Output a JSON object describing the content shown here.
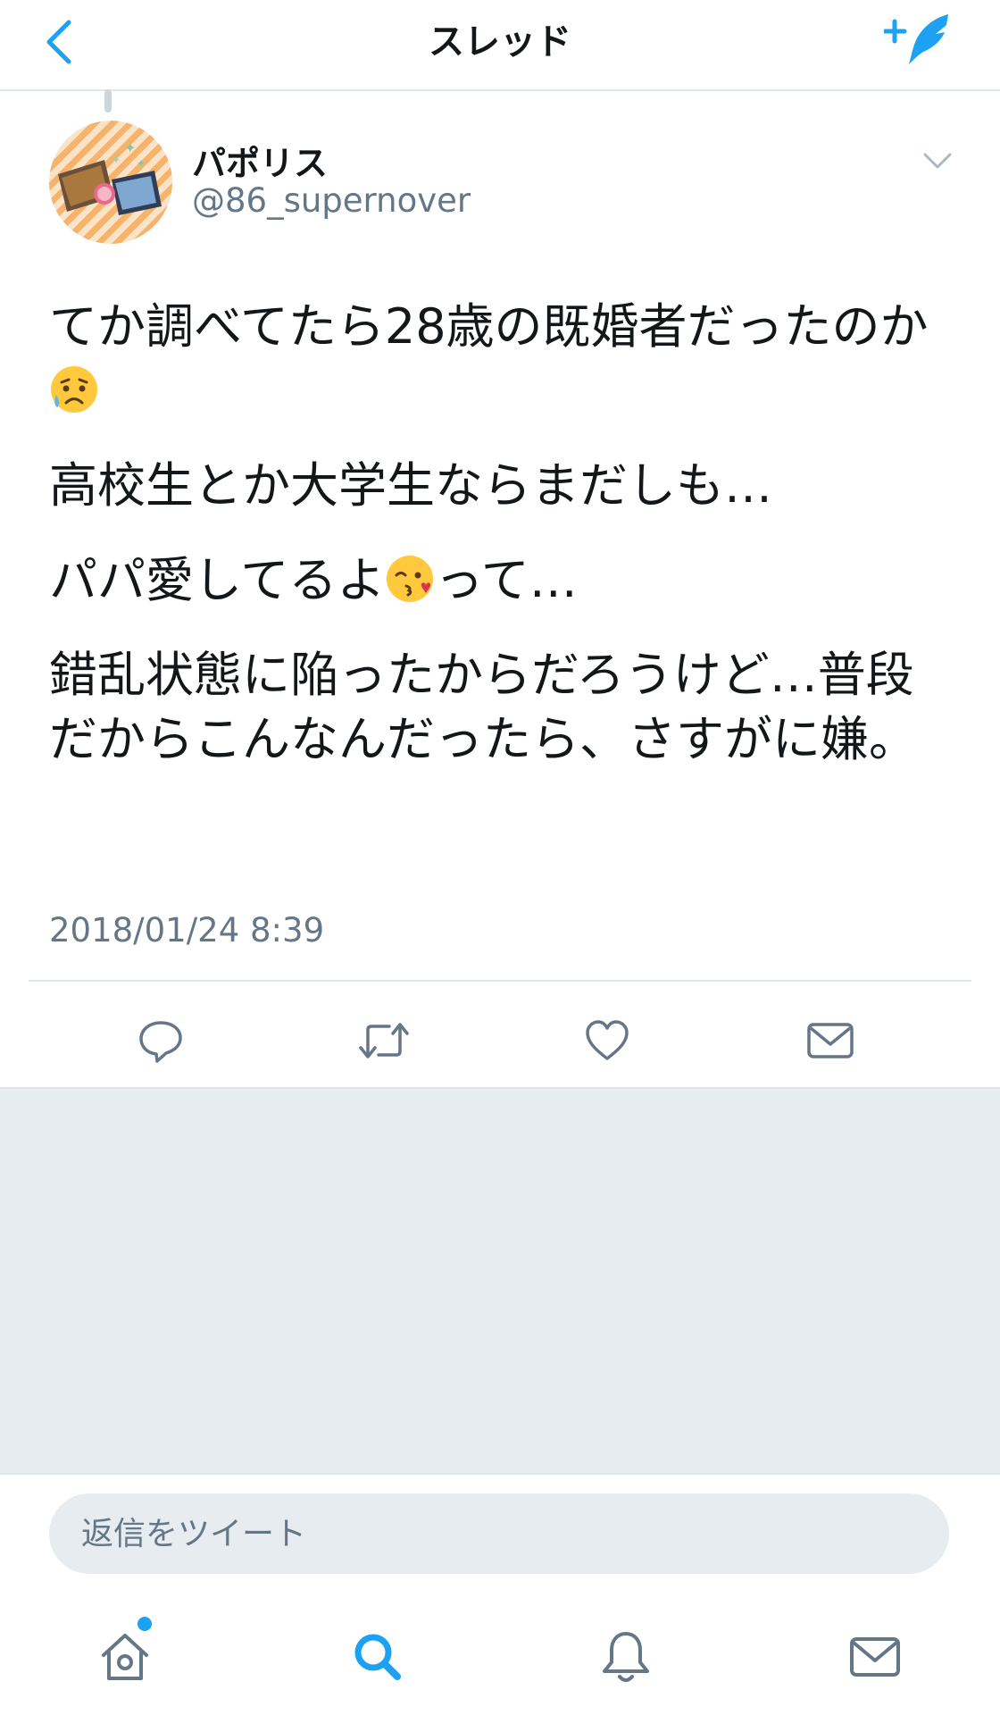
{
  "header": {
    "title": "スレッド",
    "back_icon": "chevron-left-icon",
    "compose_icon": "compose-tweet-icon"
  },
  "tweet": {
    "display_name": "パポリス",
    "username": "@86_supernover",
    "text": {
      "p1_a": "てか調べてたら28歳の既婚者だったのか",
      "p2": "高校生とか大学生ならまだしも…",
      "p3_a": "パパ愛してるよ",
      "p3_b": "って…",
      "p4": "錯乱状態に陥ったからだろうけど…普段だからこんなんだったら、さすがに嫌。"
    },
    "emojis": [
      "sad-relieved-face-emoji",
      "face-blowing-kiss-emoji"
    ],
    "timestamp": "2018/01/24 8:39"
  },
  "actions": [
    "reply-icon",
    "retweet-icon",
    "like-icon",
    "direct-message-icon"
  ],
  "reply_bar": {
    "placeholder": "返信をツイート"
  },
  "tab_bar": {
    "tabs": [
      "home-icon",
      "search-icon",
      "notifications-icon",
      "messages-icon"
    ],
    "active": "search-icon"
  },
  "colors": {
    "accent": "#1da1f2",
    "secondary_text": "#657786",
    "background_gray": "#e6ecf0"
  }
}
